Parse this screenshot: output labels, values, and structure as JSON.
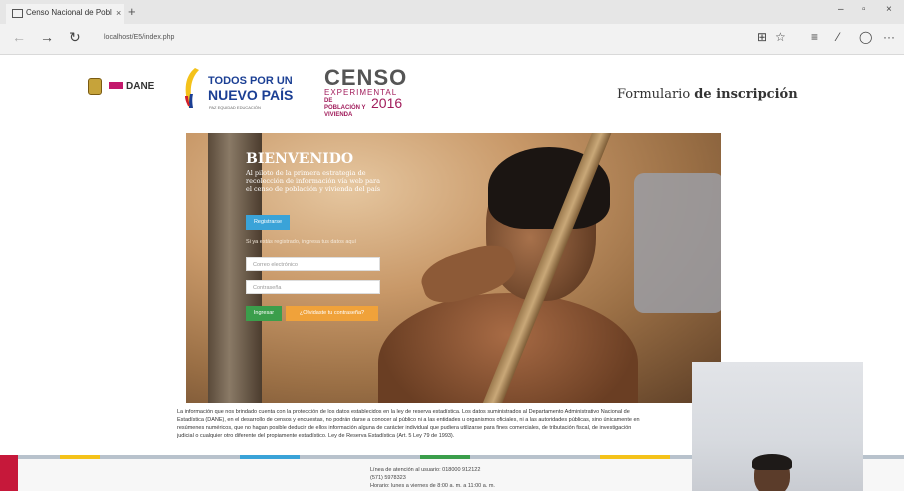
{
  "browser": {
    "tab_title": "Censo Nacional de Pobl",
    "tab_close": "×",
    "new_tab": "+",
    "address": "localhost/E5/index.php",
    "controls": {
      "minimize": "–",
      "maximize": "▫",
      "close": "×"
    },
    "tools": {
      "reading": "⊞",
      "favorite": "☆",
      "hub": "≡",
      "note": "⁄",
      "share": "◯",
      "more": "···"
    }
  },
  "header": {
    "dane_label": "DANE",
    "todos_line1": "TODOS POR UN",
    "todos_line2": "NUEVO PAÍS",
    "todos_line3": "PAZ  EQUIDAD  EDUCACIÓN",
    "censo_title": "CENSO",
    "censo_sub": "EXPERIMENTAL",
    "censo_sub2": "DE POBLACIÓN Y VIVIENDA",
    "censo_year": "2016",
    "form_title_light": "Formulario ",
    "form_title_bold": "de inscripción"
  },
  "hero": {
    "heading": "BIENVENIDO",
    "intro": "Al piloto de la primera estrategia de recolección de información vía web para el censo de población y vivienda del país",
    "register_button": "Registrarse",
    "hint": "Si ya estás registrado, ingresa tus datos aquí",
    "email_placeholder": "Correo electrónico",
    "password_placeholder": "Contraseña",
    "login_button": "Ingresar",
    "forgot_button": "¿Olvidaste tu contraseña?"
  },
  "legal": {
    "line1": "La información que nos brindado cuenta con la protección de los datos establecidos en la ley de reserva estadística. Los datos suministrados al Departamento Administrativo Nacional de",
    "line2": "Estadística (DANE), en el desarrollo de censos y encuestas, no podrán darse a conocer al público ni a las entidades u organismos oficiales, ni a las autoridades públicas, sino únicamente en",
    "line3": "resúmenes numéricos, que no hagan posible deducir de ellos información alguna de carácter individual que pudiera utilizarse para fines comerciales, de tributación fiscal, de investigación",
    "line4": "judicial o cualquier otro diferente del propiamente estadístico. Ley de Reserva Estadística (Art. 5 Ley 79 de 1993)."
  },
  "footer": {
    "line1": "Línea de atención al usuario: 018000 912122",
    "line2": "(571) 5978323",
    "line3": "Horario: lunes a viernes de 8:00 a. m. a 11:00 a. m."
  }
}
